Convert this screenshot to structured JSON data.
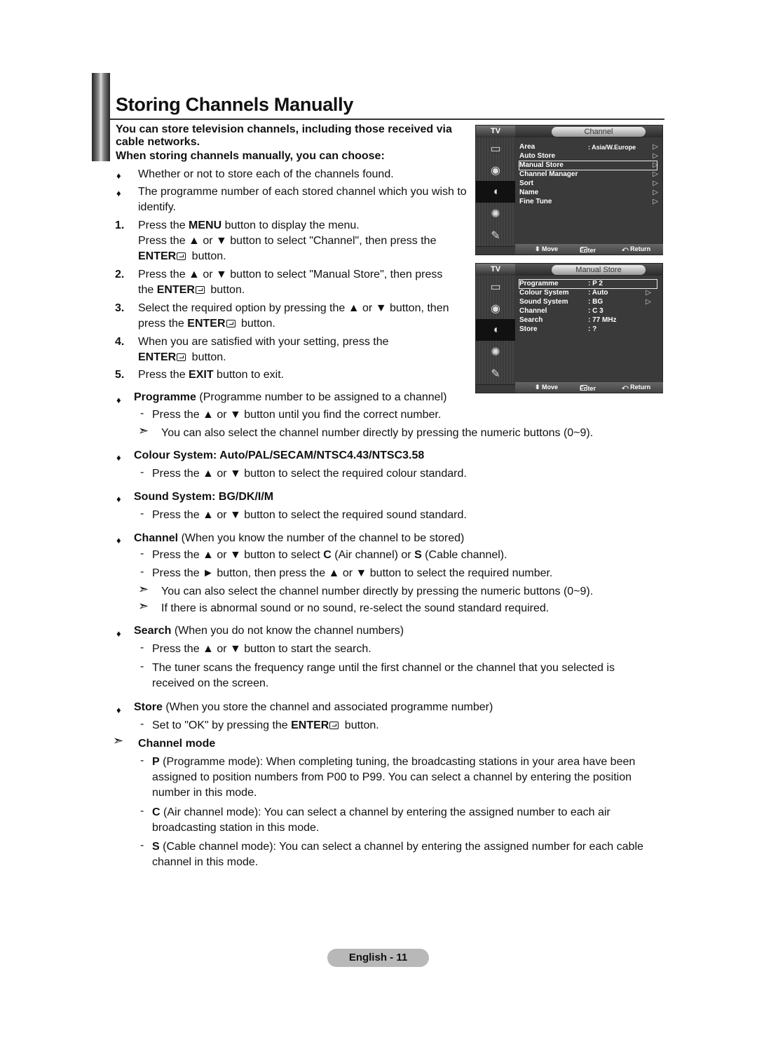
{
  "title": "Storing Channels Manually",
  "intro": {
    "line1": "You can store television channels, including those received via cable networks.",
    "line2": "When storing channels manually, you can choose:"
  },
  "choices": [
    "Whether or not to store each of the channels found.",
    "The programme number of each stored channel which you wish to identify."
  ],
  "steps": [
    {
      "num": "1.",
      "pre": "Press the ",
      "bold": "MENU",
      "post": " button to display the menu.",
      "line2": "Press the ▲ or ▼ button to select \"Channel\", then press the",
      "line3_bold": "ENTER",
      "line3": " button."
    },
    {
      "num": "2.",
      "text": "Press the ▲ or ▼ button to select \"Manual Store\", then press",
      "line2_pre": "the ",
      "line2_bold": "ENTER",
      "line2": " button."
    },
    {
      "num": "3.",
      "text": "Select the required option by pressing the ▲ or ▼ button, then",
      "line2_pre": "press the ",
      "line2_bold": "ENTER",
      "line2": " button."
    },
    {
      "num": "4.",
      "text": "When you are satisfied with your setting, press the",
      "line2_bold": "ENTER",
      "line2": " button."
    },
    {
      "num": "5.",
      "pre": "Press the ",
      "bold": "EXIT",
      "post": " button to exit."
    }
  ],
  "osd_channel": {
    "tv_label": "TV",
    "tab": "Channel",
    "items": [
      {
        "label": "Area",
        "value": ": Asia/W.Europe",
        "arrow": "▷"
      },
      {
        "label": "Auto Store",
        "value": "",
        "arrow": "▷"
      },
      {
        "label": "Manual Store",
        "value": "",
        "arrow": "▷",
        "selected": true
      },
      {
        "label": "Channel Manager",
        "value": "",
        "arrow": "▷"
      },
      {
        "label": "Sort",
        "value": "",
        "arrow": "▷"
      },
      {
        "label": "Name",
        "value": "",
        "arrow": "▷"
      },
      {
        "label": "Fine Tune",
        "value": "",
        "arrow": "▷"
      }
    ],
    "footer": {
      "move": "⬍ Move",
      "enter": "Enter",
      "ret": "⤺ Return"
    }
  },
  "osd_manual": {
    "tv_label": "TV",
    "tab": "Manual Store",
    "items": [
      {
        "label": "Programme",
        "value": ": P 2",
        "arrow": "",
        "selected": true
      },
      {
        "label": "Colour System",
        "value": ": Auto",
        "arrow": "▷"
      },
      {
        "label": "Sound System",
        "value": ": BG",
        "arrow": "▷"
      },
      {
        "label": "Channel",
        "value": ": C 3",
        "arrow": ""
      },
      {
        "label": "Search",
        "value": ": 77 MHz",
        "arrow": ""
      },
      {
        "label": "Store",
        "value": ": ?",
        "arrow": ""
      }
    ],
    "footer": {
      "move": "⬍ Move",
      "enter": "Enter",
      "ret": "⤺ Return"
    }
  },
  "sections": {
    "programme": {
      "bold": "Programme",
      "text": " (Programme number to be assigned to a channel)",
      "d1": "Press the ▲ or ▼ button until you find the correct number.",
      "n1": "You can also select the channel number directly by pressing the numeric buttons (0~9)."
    },
    "colour": {
      "bold": "Colour System: Auto/PAL/SECAM/NTSC4.43/NTSC3.58",
      "d1": "Press the ▲ or ▼ button to select the required colour standard."
    },
    "sound": {
      "bold": "Sound System: BG/DK/I/M",
      "d1": "Press the ▲ or ▼ button to select the required sound standard."
    },
    "channel": {
      "bold": "Channel",
      "text": " (When you know the number of the channel to be stored)",
      "d1_pre": "Press the ▲ or ▼ button to select ",
      "d1_c": "C",
      "d1_mid": " (Air channel) or ",
      "d1_s": "S",
      "d1_post": " (Cable channel).",
      "d2": "Press the ► button, then press the ▲ or ▼ button to select the required number.",
      "n1": "You can also select the channel number directly by pressing the numeric buttons (0~9).",
      "n2": "If there is abnormal sound or no sound, re-select the sound standard required."
    },
    "search": {
      "bold": "Search",
      "text": " (When you do not know the channel numbers)",
      "d1": "Press the ▲ or ▼ button to start the search.",
      "d2a": "The tuner scans the frequency range until the first channel or the channel that you selected is",
      "d2b": "received on the screen."
    },
    "store": {
      "bold": "Store",
      "text": " (When you store the channel and associated programme number)",
      "d1_pre": "Set to \"OK\" by pressing the ",
      "d1_bold": "ENTER",
      "d1_post": " button."
    },
    "mode": {
      "heading": "Channel mode",
      "p_bold": "P",
      "p1": " (Programme mode): When completing tuning, the broadcasting stations in your area have been",
      "p2": "assigned to position numbers from P00 to P99. You can select a channel by entering the position",
      "p3": "number in this mode.",
      "c_bold": "C",
      "c1": " (Air channel mode): You can select a channel by entering the assigned number to each air",
      "c2": "broadcasting station in this mode.",
      "s_bold": "S",
      "s1": " (Cable channel mode): You can select a channel by entering the assigned number for each cable",
      "s2": "channel in this mode."
    }
  },
  "symbols": {
    "bullet": "♦",
    "dash": "-",
    "note": "➣"
  },
  "footer": "English - 11"
}
